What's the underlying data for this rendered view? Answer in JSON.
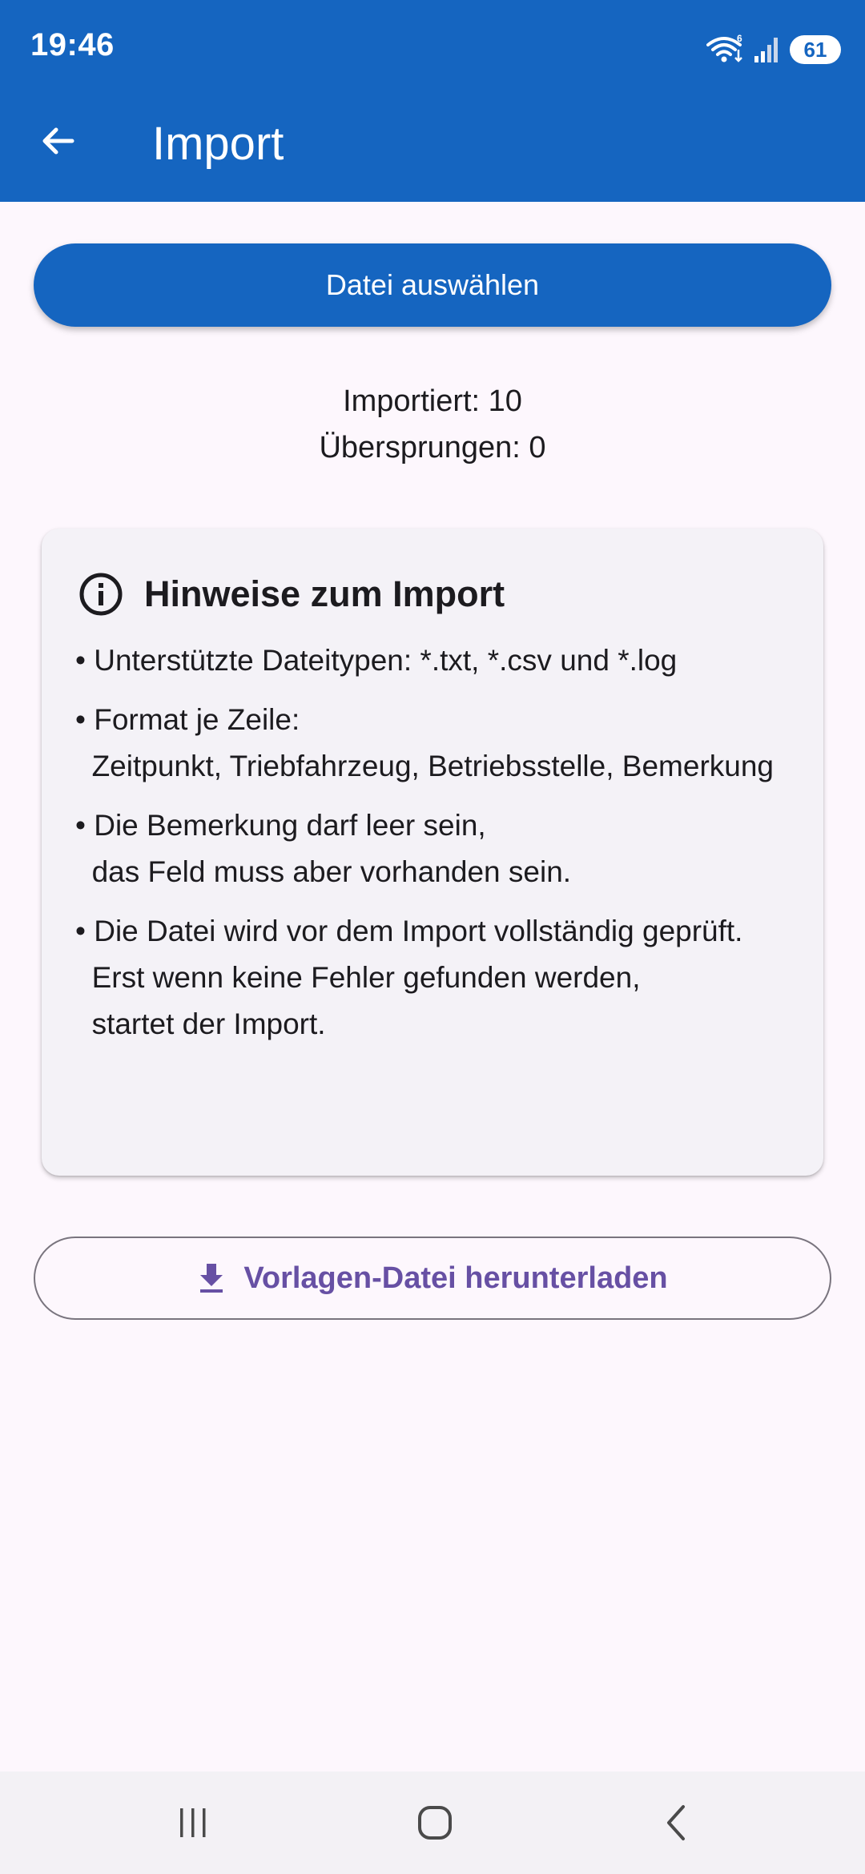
{
  "status_bar": {
    "time": "19:46",
    "network_badge": "6",
    "battery": "61",
    "icons": [
      "wifi-icon",
      "signal-icon",
      "battery-icon"
    ]
  },
  "app_bar": {
    "title": "Import",
    "back_icon": "arrow-back-icon"
  },
  "actions": {
    "select_file_label": "Datei auswählen",
    "download_template_label": "Vorlagen-Datei herunterladen",
    "download_icon": "download-icon"
  },
  "stats": {
    "imported": "Importiert: 10",
    "skipped": "Übersprungen: 0"
  },
  "info_card": {
    "icon": "info-icon",
    "title": "Hinweise zum Import",
    "notes": [
      "• Unterstützte Dateitypen: *.txt, *.csv und *.log",
      "• Format je Zeile:\n  Zeitpunkt, Triebfahrzeug, Betriebsstelle, Bemerkung",
      "• Die Bemerkung darf leer sein,\n  das Feld muss aber vorhanden sein.",
      "• Die Datei wird vor dem Import vollständig geprüft.\n  Erst wenn keine Fehler gefunden werden,\n  startet der Import."
    ]
  },
  "colors": {
    "primary": "#1565c0",
    "accent_text": "#6750a4",
    "background": "#fdf7fd",
    "card": "#f4f2f7"
  },
  "nav_bar": {
    "icons": [
      "recent-apps-icon",
      "home-icon",
      "back-icon"
    ]
  }
}
